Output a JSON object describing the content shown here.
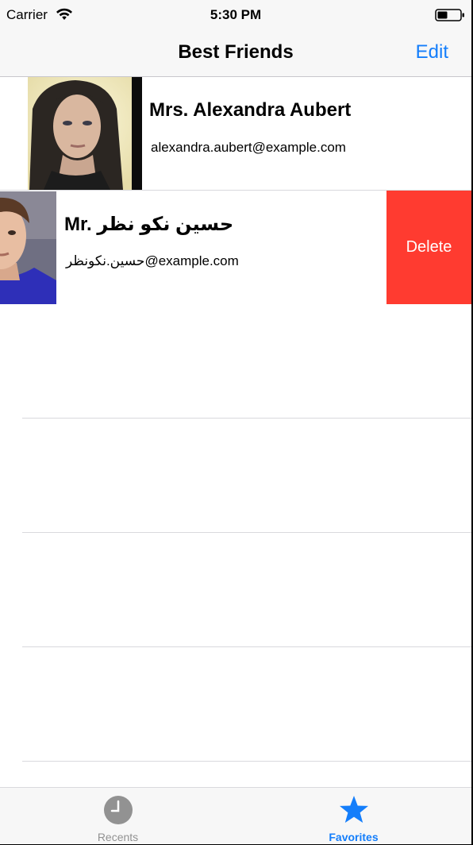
{
  "status_bar": {
    "carrier": "Carrier",
    "time": "5:30 PM",
    "wifi_icon": "wifi-icon",
    "battery_icon": "battery-icon"
  },
  "nav_bar": {
    "title": "Best Friends",
    "edit_label": "Edit",
    "accent_color": "#147efb"
  },
  "contacts": [
    {
      "name": "Mrs. Alexandra Aubert",
      "email": "alexandra.aubert@example.com",
      "photo": "avatar-woman"
    },
    {
      "name": "Mr. حسين نكو نظر",
      "email": "حسين.نكونظر@example.com",
      "photo": "avatar-man"
    }
  ],
  "swipe_action": {
    "label": "Delete",
    "color": "#ff3b30"
  },
  "tab_bar": {
    "tabs": [
      {
        "label": "Recents",
        "icon": "clock-icon",
        "selected": false
      },
      {
        "label": "Favorites",
        "icon": "star-icon",
        "selected": true
      }
    ]
  }
}
